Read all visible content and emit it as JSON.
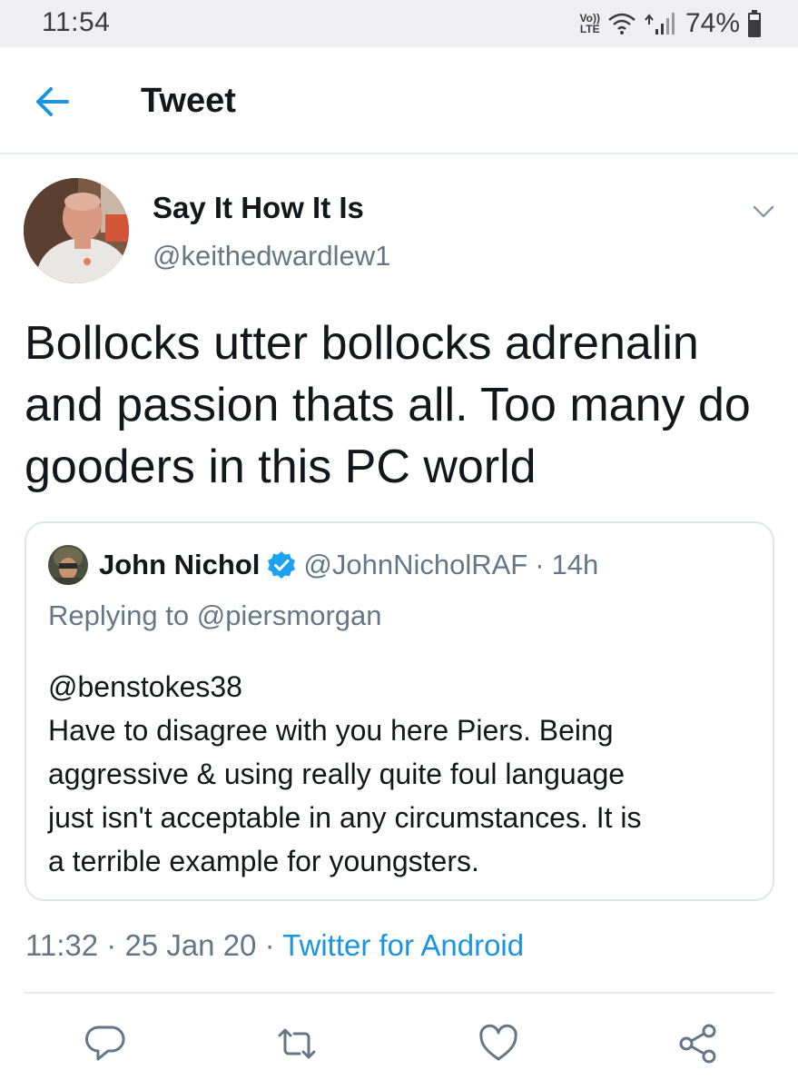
{
  "status_bar": {
    "time": "11:54",
    "volte_top": "Vo))",
    "volte_bottom": "LTE",
    "battery": "74%"
  },
  "app_bar": {
    "back_icon": "arrow-left-icon",
    "title": "Tweet"
  },
  "tweet": {
    "author_name": "Say It How It Is",
    "author_handle": "@keithedwardlew1",
    "text": "Bollocks utter bollocks adrenalin and passion thats all. Too many do gooders in this PC world",
    "timestamp": "11:32 · 25 Jan 20 · ",
    "source": "Twitter for Android"
  },
  "quoted_tweet": {
    "name": "John Nichol",
    "handle": "@JohnNicholRAF",
    "separator": "·",
    "age": "14h",
    "replying_to_prefix": "Replying to ",
    "replying_to_handle": "@piersmorgan",
    "lines": [
      "@benstokes38",
      "Have to disagree with you here Piers. Being",
      "aggressive & using really quite foul language",
      "just isn't acceptable in any circumstances. It is",
      "a terrible example for youngsters."
    ]
  },
  "actions": {
    "reply_icon": "reply-icon",
    "retweet_icon": "retweet-icon",
    "like_icon": "heart-icon",
    "share_icon": "share-icon"
  },
  "colors": {
    "accent": "#1b95e0",
    "muted": "#657786",
    "text": "#14171a",
    "border": "#e6ecf0"
  }
}
